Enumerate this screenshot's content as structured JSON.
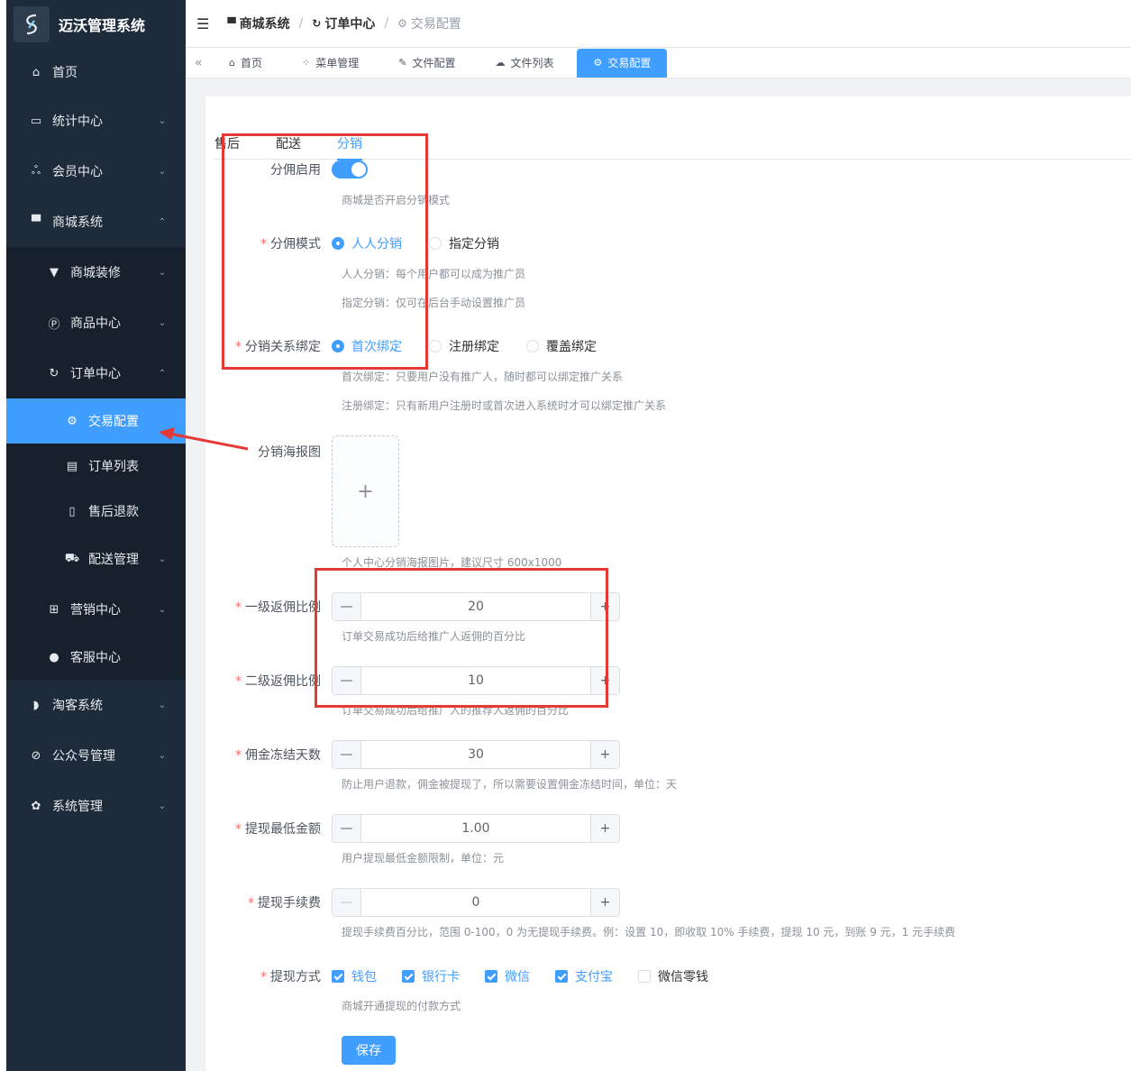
{
  "app": {
    "title": "迈沃管理系统"
  },
  "sidebar": {
    "items": [
      {
        "label": "首页",
        "icon": "home-icon"
      },
      {
        "label": "统计中心",
        "icon": "chart-icon"
      },
      {
        "label": "会员中心",
        "icon": "members-icon"
      },
      {
        "label": "商城系统",
        "icon": "shop-icon"
      },
      {
        "label": "淘客系统",
        "icon": "taoke-icon"
      },
      {
        "label": "公众号管理",
        "icon": "compass-icon"
      },
      {
        "label": "系统管理",
        "icon": "gear-icon"
      }
    ],
    "shop_sub": [
      {
        "label": "商城装修",
        "icon": "brush-icon"
      },
      {
        "label": "商品中心",
        "icon": "product-icon"
      },
      {
        "label": "订单中心",
        "icon": "order-icon"
      },
      {
        "label": "营销中心",
        "icon": "gift-icon"
      },
      {
        "label": "客服中心",
        "icon": "user-icon"
      }
    ],
    "order_sub": [
      {
        "label": "交易配置",
        "icon": "gear-icon"
      },
      {
        "label": "订单列表",
        "icon": "clipboard-icon"
      },
      {
        "label": "售后退款",
        "icon": "refund-icon"
      },
      {
        "label": "配送管理",
        "icon": "cart-icon"
      }
    ]
  },
  "breadcrumb": {
    "items": [
      "商城系统",
      "订单中心",
      "交易配置"
    ]
  },
  "tags": [
    "首页",
    "菜单管理",
    "文件配置",
    "文件列表",
    "交易配置"
  ],
  "tabs": [
    "售后",
    "配送",
    "分销"
  ],
  "form": {
    "enable": {
      "label": "分佣启用",
      "hint": "商城是否开启分销模式",
      "value": true
    },
    "mode": {
      "label": "分佣模式",
      "options": [
        "人人分销",
        "指定分销"
      ],
      "selected": "人人分销",
      "hint1": "人人分销：每个用户都可以成为推广员",
      "hint2": "指定分销：仅可在后台手动设置推广员"
    },
    "bind": {
      "label": "分销关系绑定",
      "options": [
        "首次绑定",
        "注册绑定",
        "覆盖绑定"
      ],
      "selected": "首次绑定",
      "hint1": "首次绑定：只要用户没有推广人，随时都可以绑定推广关系",
      "hint2": "注册绑定：只有新用户注册时或首次进入系统时才可以绑定推广关系"
    },
    "poster": {
      "label": "分销海报图",
      "hint": "个人中心分销海报图片，建议尺寸 600x1000"
    },
    "level1": {
      "label": "一级返佣比例",
      "value": "20",
      "hint": "订单交易成功后给推广人返佣的百分比"
    },
    "level2": {
      "label": "二级返佣比例",
      "value": "10",
      "hint": "订单交易成功后给推广人的推荐人返佣的百分比"
    },
    "freeze": {
      "label": "佣金冻结天数",
      "value": "30",
      "hint": "防止用户退款，佣金被提现了，所以需要设置佣金冻结时间，单位：天"
    },
    "min_withdraw": {
      "label": "提现最低金额",
      "value": "1.00",
      "hint": "用户提现最低金额限制，单位：元"
    },
    "fee": {
      "label": "提现手续费",
      "value": "0",
      "hint": "提现手续费百分比，范围 0-100，0 为无提现手续费。例：设置 10，即收取 10% 手续费，提现 10 元，到账 9 元，1 元手续费"
    },
    "method": {
      "label": "提现方式",
      "options": [
        "钱包",
        "银行卡",
        "微信",
        "支付宝",
        "微信零钱"
      ],
      "checked": [
        true,
        true,
        true,
        true,
        false
      ],
      "hint": "商城开通提现的付款方式"
    },
    "save_label": "保存"
  },
  "colors": {
    "primary": "#409eff",
    "sidebar_bg": "#1d2b3a",
    "annotation": "#e53935"
  }
}
